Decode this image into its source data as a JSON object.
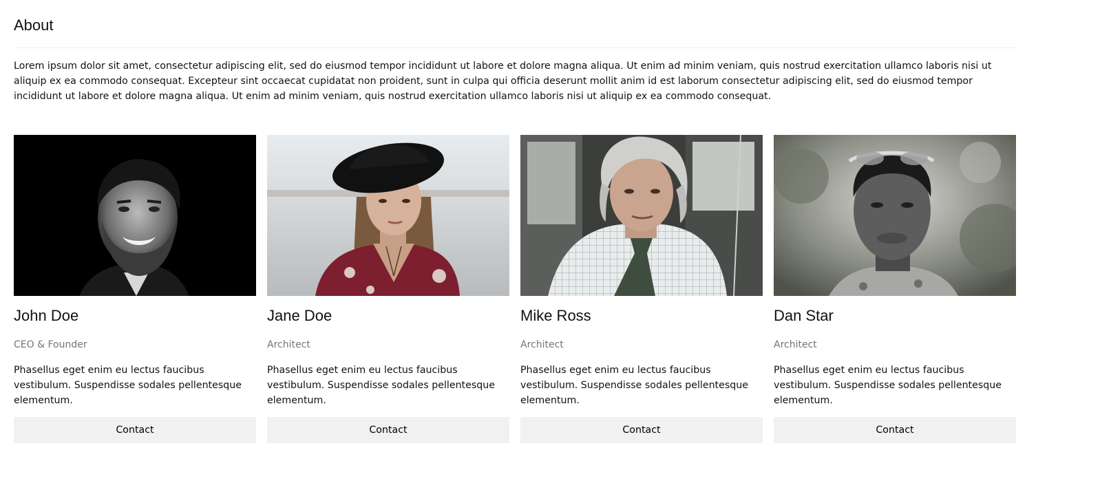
{
  "about": {
    "title": "About",
    "text": "Lorem ipsum dolor sit amet, consectetur adipiscing elit, sed do eiusmod tempor incididunt ut labore et dolore magna aliqua. Ut enim ad minim veniam, quis nostrud exercitation ullamco laboris nisi ut aliquip ex ea commodo consequat. Excepteur sint occaecat cupidatat non proident, sunt in culpa qui officia deserunt mollit anim id est laborum consectetur adipiscing elit, sed do eiusmod tempor incididunt ut labore et dolore magna aliqua. Ut enim ad minim veniam, quis nostrud exercitation ullamco laboris nisi ut aliquip ex ea commodo consequat."
  },
  "team": [
    {
      "name": "John Doe",
      "title": "CEO & Founder",
      "description": "Phasellus eget enim eu lectus faucibus vestibulum. Suspendisse sodales pellentesque elementum.",
      "contact_label": "Contact"
    },
    {
      "name": "Jane Doe",
      "title": "Architect",
      "description": "Phasellus eget enim eu lectus faucibus vestibulum. Suspendisse sodales pellentesque elementum.",
      "contact_label": "Contact"
    },
    {
      "name": "Mike Ross",
      "title": "Architect",
      "description": "Phasellus eget enim eu lectus faucibus vestibulum. Suspendisse sodales pellentesque elementum.",
      "contact_label": "Contact"
    },
    {
      "name": "Dan Star",
      "title": "Architect",
      "description": "Phasellus eget enim eu lectus faucibus vestibulum. Suspendisse sodales pellentesque elementum.",
      "contact_label": "Contact"
    }
  ],
  "colors": {
    "button_bg": "#f1f1f1",
    "muted_text": "#757575",
    "divider": "#eeeeee"
  }
}
